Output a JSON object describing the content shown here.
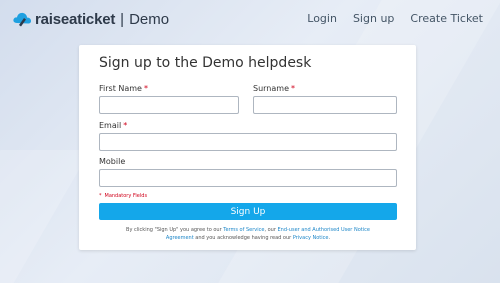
{
  "brand": {
    "name": "raiseaticket",
    "separator": "|",
    "suffix": "Demo",
    "icon": "cloud-ticket-icon",
    "color": "#2e3a4a"
  },
  "nav": {
    "login": "Login",
    "signup": "Sign up",
    "create_ticket": "Create Ticket"
  },
  "form": {
    "title": "Sign up to the Demo helpdesk",
    "first_name_label": "First Name",
    "surname_label": "Surname",
    "email_label": "Email",
    "mobile_label": "Mobile",
    "required_marker": "*",
    "first_name_value": "",
    "surname_value": "",
    "email_value": "",
    "mobile_value": "",
    "mandatory_note": "Mandatory Fields",
    "submit_label": "Sign Up",
    "terms": {
      "part1": "By clicking \"Sign Up\" you agree to our ",
      "link1": "Terms of Service",
      "part2": ", our ",
      "link2": "End-user and Authorised User Notice Agreement",
      "part3": " and you acknowledge having read our ",
      "link3": "Privacy Notice",
      "part4": "."
    }
  },
  "colors": {
    "accent": "#14a7ea",
    "link": "#1c86c8",
    "required": "#d0021b"
  }
}
